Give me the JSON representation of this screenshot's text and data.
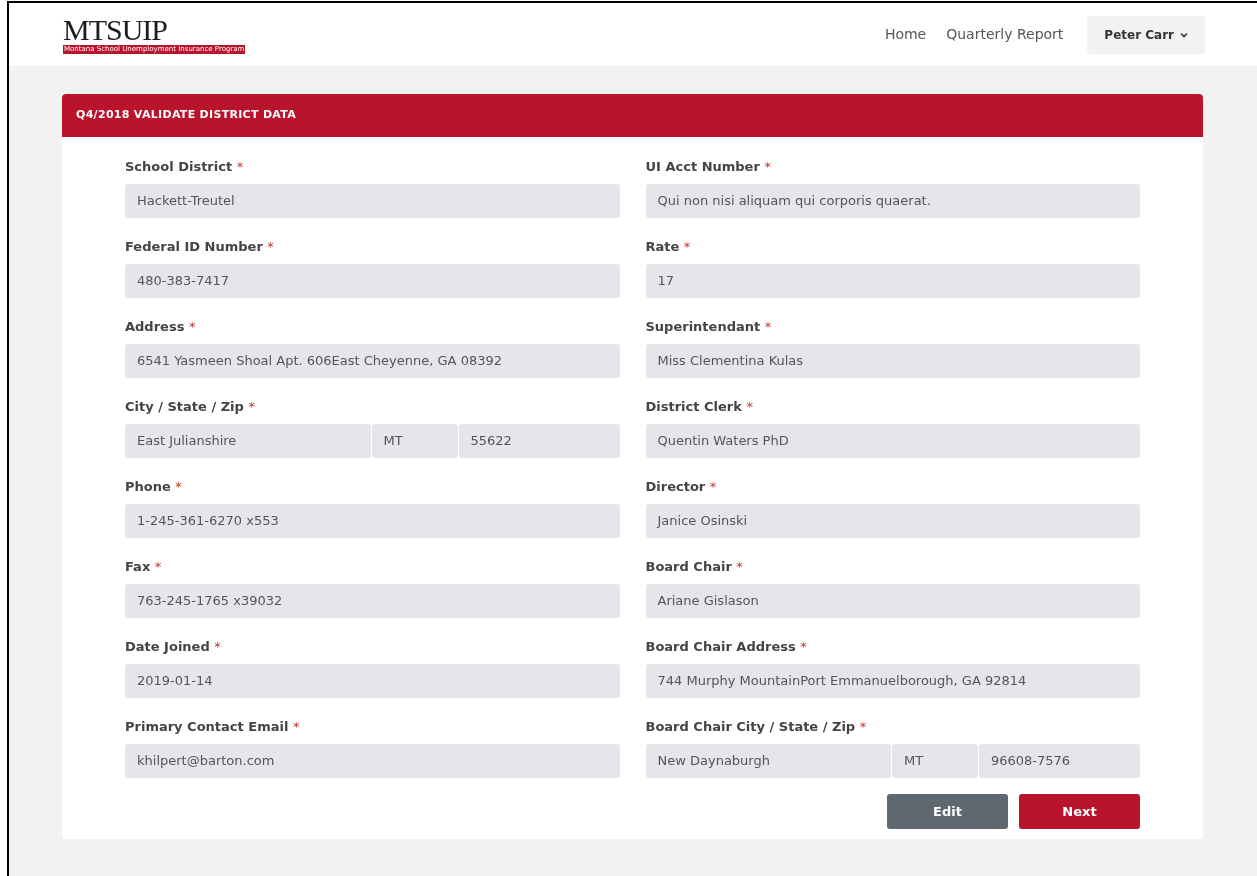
{
  "logo": {
    "text": "MTSUIP",
    "subtitle": "Montana School Unemployment Insurance Program"
  },
  "nav": {
    "links": [
      "Home",
      "Quarterly Report"
    ],
    "user": "Peter Carr"
  },
  "card": {
    "title": "Q4/2018 VALIDATE DISTRICT DATA"
  },
  "required_mark": "*",
  "left_fields": [
    {
      "kind": "single",
      "label": "School District",
      "values": [
        "Hackett-Treutel"
      ]
    },
    {
      "kind": "single",
      "label": "Federal ID Number",
      "values": [
        "480-383-7417"
      ]
    },
    {
      "kind": "single",
      "label": "Address",
      "values": [
        "6541 Yasmeen Shoal Apt. 606East Cheyenne, GA 08392"
      ]
    },
    {
      "kind": "triple",
      "label": "City / State / Zip",
      "values": [
        "East Julianshire",
        "MT",
        "55622"
      ]
    },
    {
      "kind": "single",
      "label": "Phone",
      "values": [
        "1-245-361-6270 x553"
      ]
    },
    {
      "kind": "single",
      "label": "Fax",
      "values": [
        "763-245-1765 x39032"
      ]
    },
    {
      "kind": "single",
      "label": "Date Joined",
      "values": [
        "2019-01-14"
      ]
    },
    {
      "kind": "single",
      "label": "Primary Contact Email",
      "values": [
        "khilpert@barton.com"
      ]
    }
  ],
  "right_fields": [
    {
      "kind": "single",
      "label": "UI Acct Number",
      "values": [
        "Qui non nisi aliquam qui corporis quaerat."
      ]
    },
    {
      "kind": "single",
      "label": "Rate",
      "values": [
        "17"
      ]
    },
    {
      "kind": "single",
      "label": "Superintendant",
      "values": [
        "Miss Clementina Kulas"
      ]
    },
    {
      "kind": "single",
      "label": "District Clerk",
      "values": [
        "Quentin Waters PhD"
      ]
    },
    {
      "kind": "single",
      "label": "Director",
      "values": [
        "Janice Osinski"
      ]
    },
    {
      "kind": "single",
      "label": "Board Chair",
      "values": [
        "Ariane Gislason"
      ]
    },
    {
      "kind": "single",
      "label": "Board Chair Address",
      "values": [
        "744 Murphy MountainPort Emmanuelborough, GA 92814"
      ]
    },
    {
      "kind": "triple",
      "label": "Board Chair City / State / Zip",
      "values": [
        "New Daynaburgh",
        "MT",
        "96608-7576"
      ]
    }
  ],
  "buttons": [
    {
      "kind": "secondary",
      "label": "Edit"
    },
    {
      "kind": "primary",
      "label": "Next"
    }
  ]
}
